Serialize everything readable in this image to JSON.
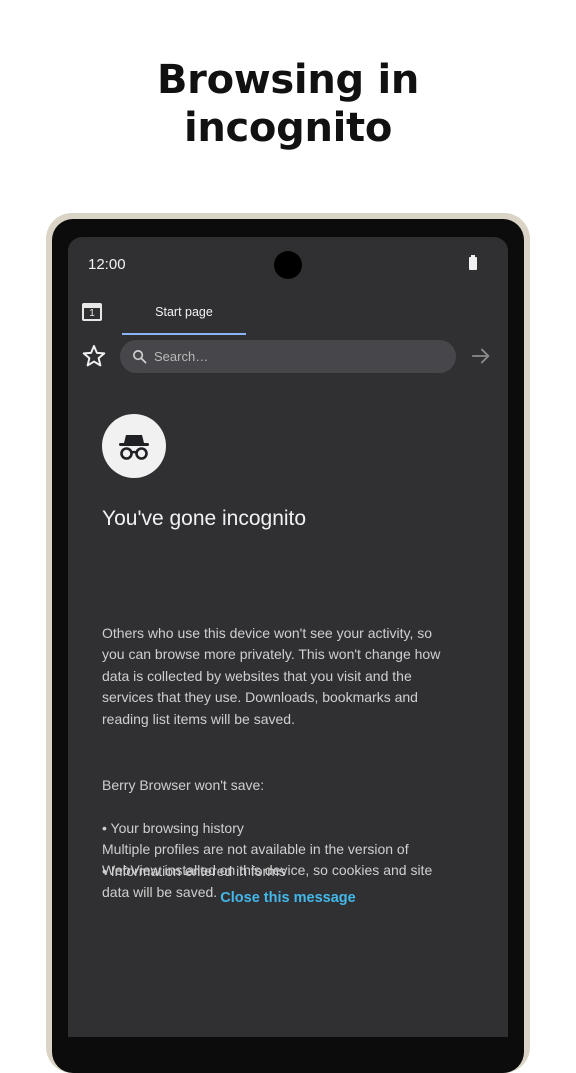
{
  "headline": "Browsing in\nincognito",
  "status_bar": {
    "time": "12:00"
  },
  "tab_strip": {
    "tab_count": "1",
    "active_tab_label": "Start page"
  },
  "toolbar": {
    "search_placeholder": "Search…"
  },
  "incognito": {
    "title": "You've gone incognito",
    "description": "Others who use this device won't see your activity, so\nyou can browse more privately. This won't change how\ndata is collected by websites that you visit and the\nservices that they use. Downloads, bookmarks and\nreading list items will be saved.",
    "wont_save_heading": "Berry Browser won't save:",
    "wont_save_items": [
      "• Your browsing history",
      "• Information entered in forms"
    ],
    "profiles_notice": "Multiple profiles are not available in the version of\nWebView installed on this device, so cookies and site\ndata will be saved.",
    "close_label": "Close this message"
  },
  "colors": {
    "screen_background": "#303033",
    "device_frame": "#d9d4c6",
    "link_accent": "#43b8ea",
    "active_tab_underline": "#8ab4f8"
  },
  "icons": {
    "tab_switcher": "tab-switcher-icon",
    "bookmark": "star-outline-icon",
    "search": "magnifier-icon",
    "go": "arrow-right-icon",
    "incognito": "incognito-hat-glasses-icon",
    "battery": "battery-icon"
  }
}
